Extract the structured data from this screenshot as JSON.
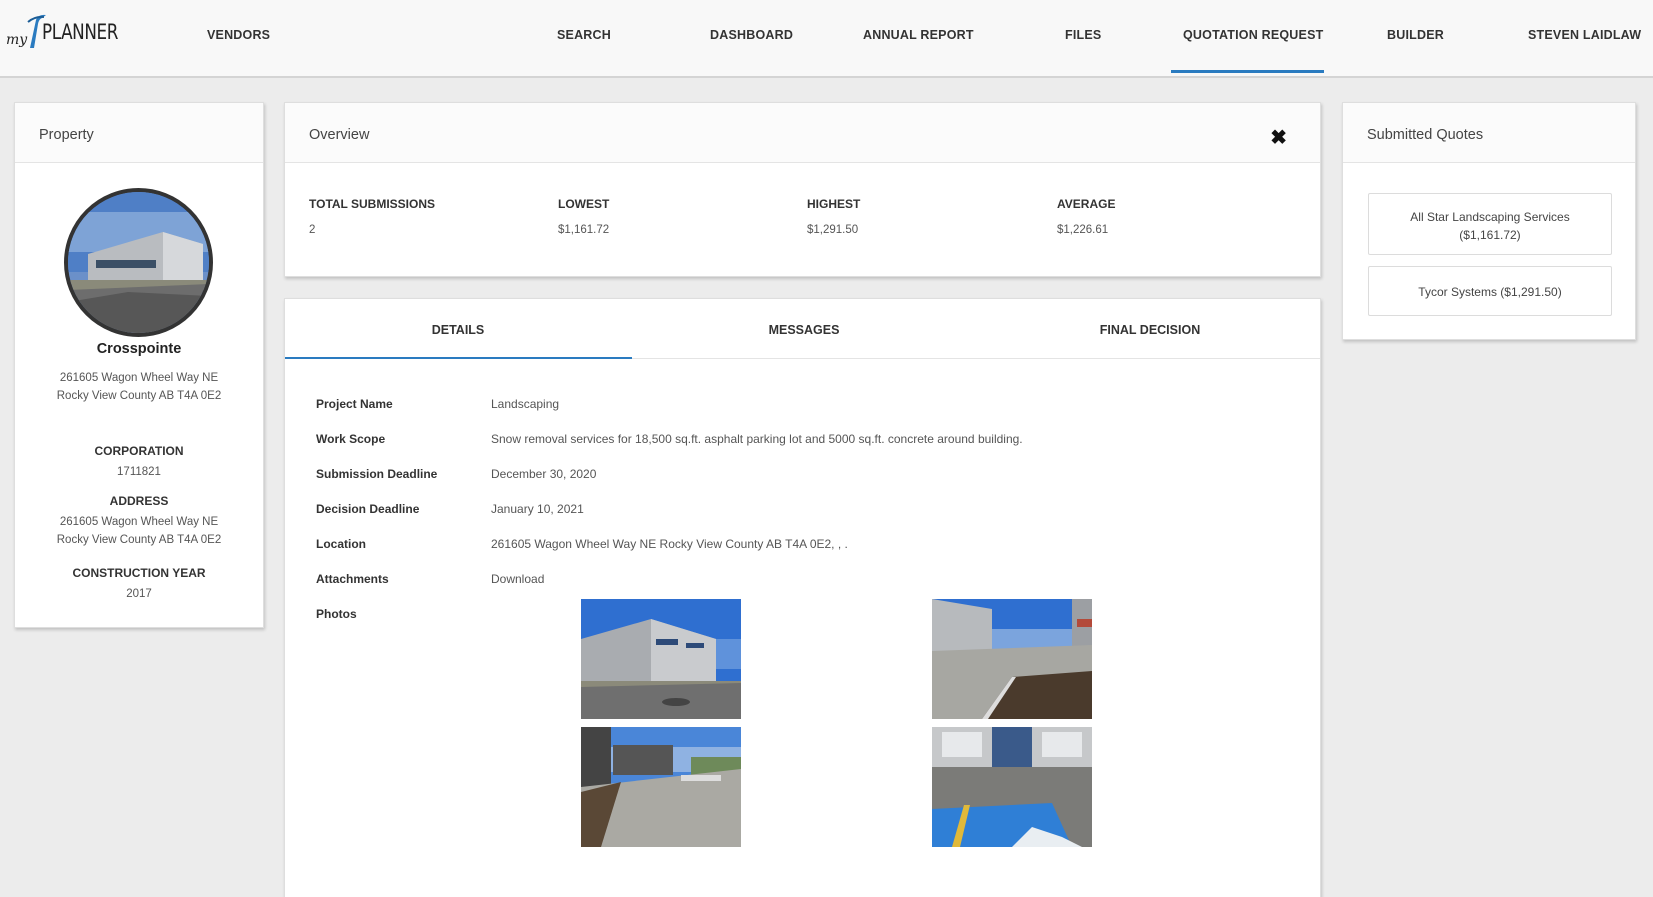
{
  "nav": {
    "logo_my": "my",
    "logo_planner": "PLANNER",
    "items": [
      "VENDORS",
      "SEARCH",
      "DASHBOARD",
      "ANNUAL REPORT",
      "FILES",
      "QUOTATION REQUEST",
      "BUILDER",
      "STEVEN LAIDLAW"
    ],
    "active": "QUOTATION REQUEST",
    "accent": "#2a7bc0"
  },
  "property": {
    "header": "Property",
    "name": "Crosspointe",
    "address_line1": "261605 Wagon Wheel Way NE",
    "address_line2": "Rocky View County AB T4A 0E2",
    "corporation_label": "CORPORATION",
    "corporation": "1711821",
    "address_label": "ADDRESS",
    "address2_line1": "261605 Wagon Wheel Way NE",
    "address2_line2": "Rocky View County AB T4A 0E2",
    "year_label": "CONSTRUCTION YEAR",
    "year": "2017"
  },
  "overview": {
    "header": "Overview",
    "close_icon": "close-icon",
    "stats": [
      {
        "label": "TOTAL SUBMISSIONS",
        "value": "2"
      },
      {
        "label": "LOWEST",
        "value": "$1,161.72"
      },
      {
        "label": "HIGHEST",
        "value": "$1,291.50"
      },
      {
        "label": "AVERAGE",
        "value": "$1,226.61"
      }
    ]
  },
  "tabs": {
    "items": [
      "DETAILS",
      "MESSAGES",
      "FINAL DECISION"
    ],
    "active": "DETAILS"
  },
  "details": {
    "project_name_label": "Project Name",
    "project_name": "Landscaping",
    "work_scope_label": "Work Scope",
    "work_scope": "Snow removal services for 18,500 sq.ft. asphalt parking lot and 5000 sq.ft. concrete around building.",
    "submission_deadline_label": "Submission Deadline",
    "submission_deadline": "December 30, 2020",
    "decision_deadline_label": "Decision Deadline",
    "decision_deadline": "January 10, 2021",
    "location_label": "Location",
    "location": "261605 Wagon Wheel Way NE Rocky View County AB T4A 0E2, , .",
    "attachments_label": "Attachments",
    "attachments": "Download",
    "photos_label": "Photos"
  },
  "quotes": {
    "header": "Submitted Quotes",
    "items": [
      {
        "line1": "All Star Landscaping Services",
        "line2": "($1,161.72)"
      },
      {
        "line1": "Tycor Systems  ($1,291.50)",
        "line2": ""
      }
    ]
  }
}
